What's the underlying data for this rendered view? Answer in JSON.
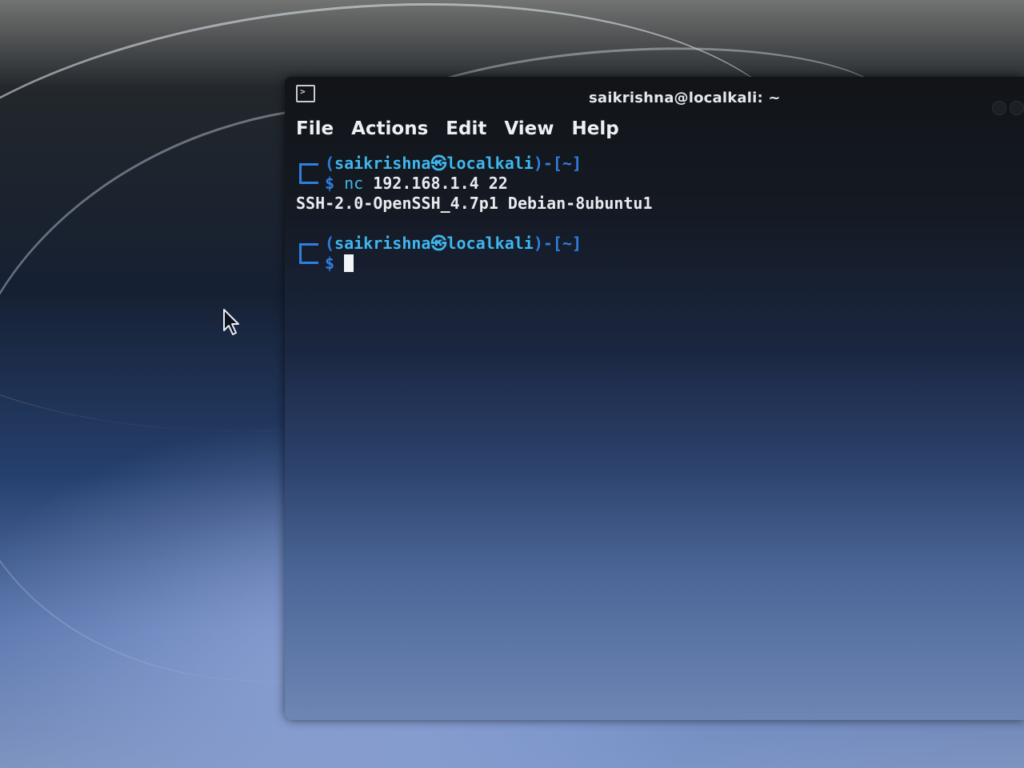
{
  "window": {
    "title": "saikrishna@localkali: ~",
    "app_icon": "terminal-icon"
  },
  "menu": {
    "items": [
      "File",
      "Actions",
      "Edit",
      "View",
      "Help"
    ]
  },
  "terminal": {
    "prompt1": {
      "open": "(",
      "user": "saikrishna",
      "at": "㉿",
      "host": "localkali",
      "close": ")-[~]",
      "dollar": "$",
      "command": "nc",
      "args": " 192.168.1.4 22"
    },
    "output_line": "SSH-2.0-OpenSSH_4.7p1 Debian-8ubuntu1",
    "prompt2": {
      "open": "(",
      "user": "saikrishna",
      "at": "㉿",
      "host": "localkali",
      "close": ")-[~]",
      "dollar": "$"
    }
  },
  "colors": {
    "prompt_blue": "#2e7fe0",
    "user_cyan": "#3fb7ee",
    "text": "#e8eaee"
  }
}
